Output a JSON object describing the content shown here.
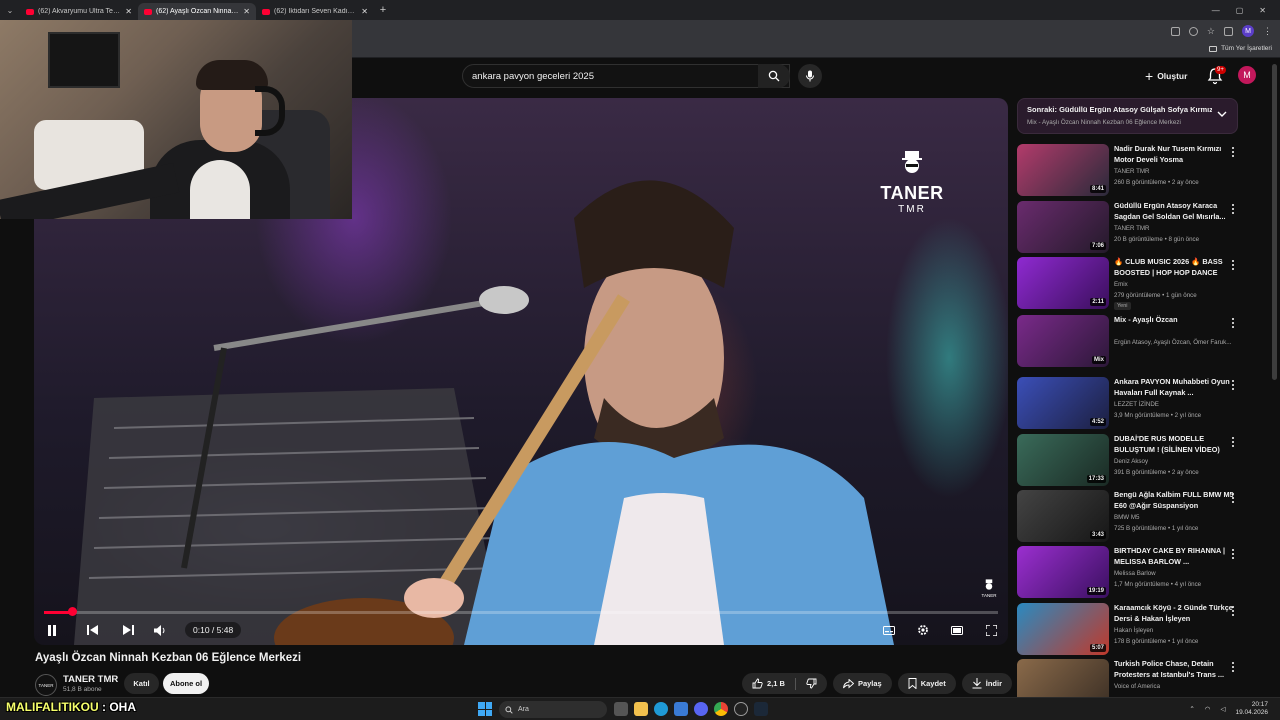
{
  "browser": {
    "tabs": [
      {
        "title": "(62) Akvaryumu Ultra Teknoloji ile...",
        "active": false
      },
      {
        "title": "(62) Ayaşlı Özcan Ninnah Kezb...",
        "active": true
      },
      {
        "title": "(62) İktidarı Seven Kadın - YouTube",
        "active": false
      }
    ],
    "new_tab": "+",
    "bookmarks_all": "Tüm Yer İşaretleri",
    "profile_initial": "M"
  },
  "header": {
    "search_value": "ankara pavyon geceleri 2025",
    "create_label": "Oluştur",
    "notif_badge": "9+",
    "avatar_initial": "M"
  },
  "player": {
    "overlay_logo_main": "TANER",
    "overlay_logo_sub": "TMR",
    "watermark": "TANER",
    "time": "0:10 / 5:48",
    "progress": 0.029
  },
  "video": {
    "title": "Ayaşlı Özcan Ninnah Kezban 06 Eğlence Merkezi",
    "channel": "TANER TMR",
    "subscribers": "51,8 B abone",
    "join_label": "Katıl",
    "subscribe_label": "Abone ol",
    "likes": "2,1 B",
    "share_label": "Paylaş",
    "save_label": "Kaydet",
    "download_label": "İndir",
    "channel_avatar_text": "TANER"
  },
  "sidebar": {
    "upnext_title": "Sonraki: Güdüllü Ergün Atasoy Gülşah Sofya Kırmızı...",
    "upnext_sub": "Mix - Ayaşlı Özcan Ninnah Kezban 06 Eğlence Merkezi",
    "items": [
      {
        "title": "Nadir Durak Nur Tusem Kırmızı Motor Develi Yosma",
        "channel": "TANER TMR",
        "meta": "260 B görüntüleme • 2 ay önce",
        "duration": "8:41",
        "c1": "#b33b6b",
        "c2": "#2a2a3a"
      },
      {
        "title": "Güdüllü Ergün Atasoy Karaca Sagdan Gel Soldan Gel Mısırla...",
        "channel": "TANER TMR",
        "meta": "20 B görüntüleme • 8 gün önce",
        "duration": "7:06",
        "c1": "#6a2b6e",
        "c2": "#241a2a"
      },
      {
        "title": "🔥 CLUB MUSIC 2026 🔥 BASS BOOSTED | HOP HOP DANCE",
        "channel": "Emix",
        "meta": "279 görüntüleme • 1 gün önce",
        "duration": "2:11",
        "c1": "#8f2ad1",
        "c2": "#3a0f5c",
        "new": "Yeni"
      },
      {
        "title": "Mix - Ayaşlı Özcan",
        "channel": "Ergün Atasoy, Ayaşlı Özcan, Ömer Faruk...",
        "meta": "",
        "duration": "Mix",
        "c1": "#7a2a8a",
        "c2": "#2c1838"
      },
      {
        "title": "Ankara PAVYON Muhabbeti Oyun Havaları Full Kaynak ...",
        "channel": "LEZZET İZİNDE",
        "meta": "3,9 Mn görüntüleme • 2 yıl önce",
        "duration": "4:52",
        "c1": "#3b4fb8",
        "c2": "#1c1f40"
      },
      {
        "title": "DUBAİ'DE RUS MODELLE BULUŞTUM ! (SİLİNEN VİDEO)",
        "channel": "Deniz Aksoy",
        "meta": "391 B görüntüleme • 2 ay önce",
        "duration": "17:33",
        "c1": "#3a6b5a",
        "c2": "#1a2a24"
      },
      {
        "title": "Bengü Ağla Kalbim FULL BMW M5 E60 @Ağır Süspansiyon",
        "channel": "BMW M5",
        "meta": "725 B görüntüleme • 1 yıl önce",
        "duration": "3:43",
        "c1": "#444444",
        "c2": "#161616"
      },
      {
        "title": "BIRTHDAY CAKE BY RIHANNA | MELISSA BARLOW ...",
        "channel": "Melissa Barlow",
        "meta": "1,7 Mn görüntüleme • 4 yıl önce",
        "duration": "19:19",
        "c1": "#9b2fd0",
        "c2": "#3a1060"
      },
      {
        "title": "Karaamcık Köyü - 2 Günde Türkçe Dersi & Hakan İşleyen",
        "channel": "Hakan İşleyen",
        "meta": "178 B görüntüleme • 1 yıl önce",
        "duration": "5:07",
        "c1": "#2a8ac0",
        "c2": "#c0392b"
      },
      {
        "title": "Turkish Police Chase, Detain Protesters at Istanbul's Trans ...",
        "channel": "Voice of America",
        "meta": "",
        "duration": "",
        "c1": "#8a6a4a",
        "c2": "#3a2e24"
      }
    ]
  },
  "taskbar": {
    "search_label": "Ara",
    "time": "20:17",
    "date": "19.04.2026"
  },
  "chat": {
    "user": "MALIFALITIKOU",
    "message": ": OHA"
  }
}
